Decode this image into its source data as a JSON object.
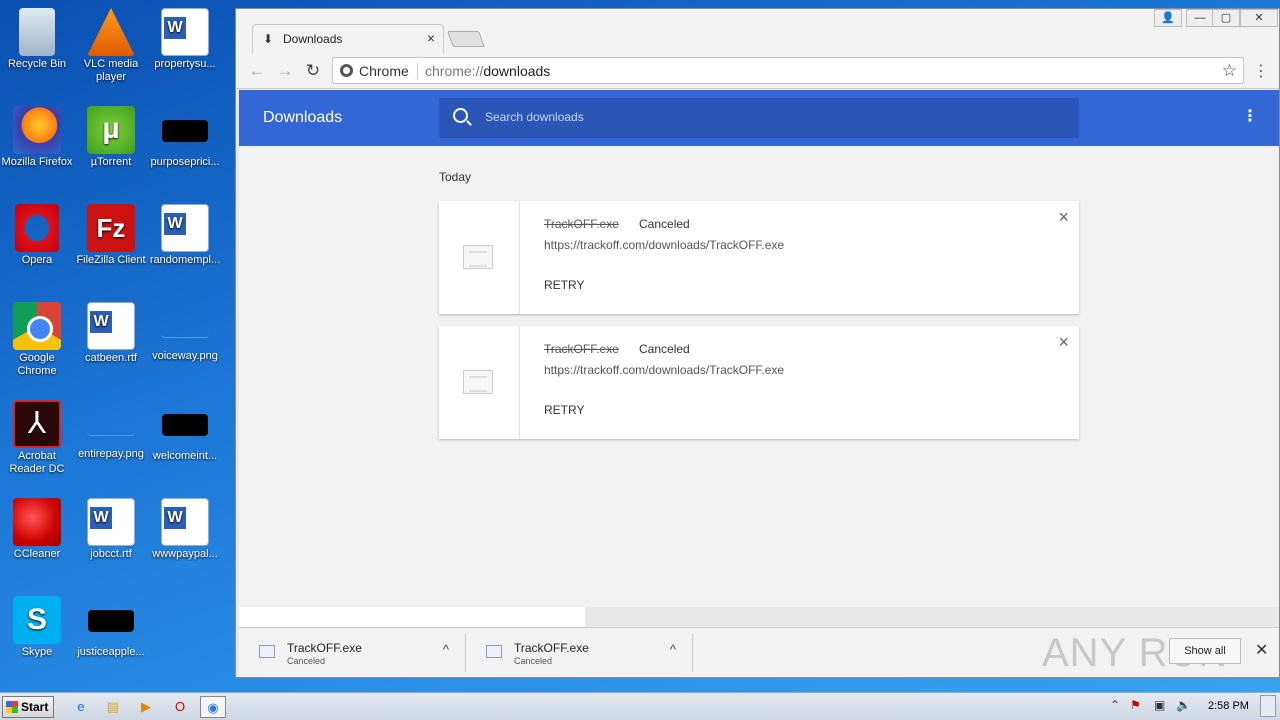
{
  "desktop": {
    "icons": [
      {
        "label": "Recycle Bin"
      },
      {
        "label": "VLC media player"
      },
      {
        "label": "propertysu..."
      },
      {
        "label": "Mozilla Firefox"
      },
      {
        "label": "µTorrent"
      },
      {
        "label": "purposeprici..."
      },
      {
        "label": "Opera"
      },
      {
        "label": "FileZilla Client"
      },
      {
        "label": "randomempl..."
      },
      {
        "label": "Google Chrome"
      },
      {
        "label": "catbeen.rtf"
      },
      {
        "label": "voiceway.png"
      },
      {
        "label": "Acrobat Reader DC"
      },
      {
        "label": "entirepay.png"
      },
      {
        "label": "welcomeint..."
      },
      {
        "label": "CCleaner"
      },
      {
        "label": "jobcct.rtf"
      },
      {
        "label": "wwwpaypal..."
      },
      {
        "label": "Skype"
      },
      {
        "label": "justiceapple..."
      }
    ]
  },
  "browser": {
    "tab": {
      "title": "Downloads",
      "close": "×"
    },
    "omnibox": {
      "chip": "Chrome",
      "url_scheme": "chrome://",
      "url_path": "downloads"
    },
    "controls": {
      "profile": "👤",
      "minimize": "—",
      "restore": "▢",
      "close": "✕"
    }
  },
  "downloads": {
    "title": "Downloads",
    "search_placeholder": "Search downloads",
    "menu": "⋮",
    "section": "Today",
    "items": [
      {
        "name": "TrackOFF.exe",
        "status": "Canceled",
        "url": "https://trackoff.com/downloads/TrackOFF.exe",
        "action": "RETRY",
        "close": "×"
      },
      {
        "name": "TrackOFF.exe",
        "status": "Canceled",
        "url": "https://trackoff.com/downloads/TrackOFF.exe",
        "action": "RETRY",
        "close": "×"
      }
    ]
  },
  "shelf": {
    "items": [
      {
        "name": "TrackOFF.exe",
        "status": "Canceled",
        "caret": "^"
      },
      {
        "name": "TrackOFF.exe",
        "status": "Canceled",
        "caret": "^"
      }
    ],
    "show_all": "Show all",
    "close": "✕",
    "watermark": "ANY RUN"
  },
  "taskbar": {
    "start": "Start",
    "clock": "2:58 PM"
  }
}
